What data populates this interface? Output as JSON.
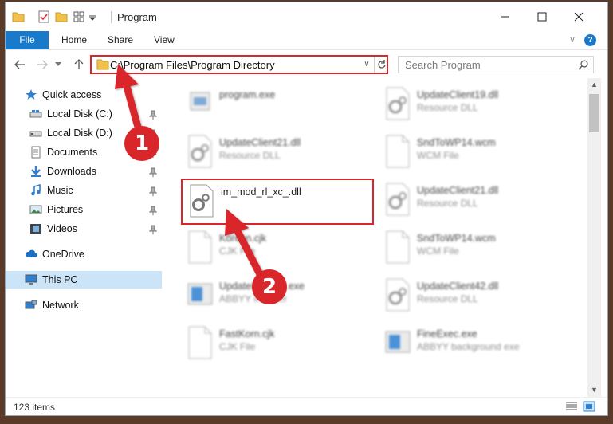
{
  "window": {
    "title": "Program",
    "controls": {
      "minimize": "minimize-icon",
      "maximize": "maximize-icon",
      "close": "close-icon"
    }
  },
  "ribbon": {
    "tabs": [
      "File",
      "Home",
      "Share",
      "View"
    ],
    "help": "?"
  },
  "address": {
    "path": "C:\\Program Files\\Program Directory",
    "search_placeholder": "Search Program"
  },
  "sidebar": {
    "quick_access": "Quick access",
    "items": [
      {
        "label": "Local Disk (C:)",
        "icon": "drive-icon",
        "pinned": true
      },
      {
        "label": "Local Disk (D:)",
        "icon": "drive-icon",
        "pinned": true
      },
      {
        "label": "Documents",
        "icon": "documents-icon",
        "pinned": true
      },
      {
        "label": "Downloads",
        "icon": "download-icon",
        "pinned": true
      },
      {
        "label": "Music",
        "icon": "music-icon",
        "pinned": true
      },
      {
        "label": "Pictures",
        "icon": "pictures-icon",
        "pinned": true
      },
      {
        "label": "Videos",
        "icon": "videos-icon",
        "pinned": true
      }
    ],
    "onedrive": "OneDrive",
    "this_pc": "This PC",
    "network": "Network"
  },
  "files": [
    {
      "name": "program.exe",
      "type": "",
      "icon": "exe-icon"
    },
    {
      "name": "UpdateClient19.dll",
      "type": "Resource DLL",
      "icon": "dll-icon"
    },
    {
      "name": "UpdateClient21.dll",
      "type": "Resource DLL",
      "icon": "dll-icon"
    },
    {
      "name": "SndToWP14.wcm",
      "type": "WCM File",
      "icon": "blank-file-icon"
    },
    {
      "name": "im_mod_rl_xc_.dll",
      "type": "",
      "icon": "dll-icon"
    },
    {
      "name": "UpdateClient21.dll",
      "type": "Resource DLL",
      "icon": "dll-icon"
    },
    {
      "name": "Korean.cjk",
      "type": "CJK File",
      "icon": "blank-file-icon"
    },
    {
      "name": "SndToWP14.wcm",
      "type": "WCM File",
      "icon": "blank-file-icon"
    },
    {
      "name": "UpdateInstaller.exe",
      "type": "ABBYY Installer",
      "icon": "exe-icon"
    },
    {
      "name": "UpdateClient42.dll",
      "type": "Resource DLL",
      "icon": "dll-icon"
    },
    {
      "name": "FastKorn.cjk",
      "type": "CJK File",
      "icon": "blank-file-icon"
    },
    {
      "name": "FineExec.exe",
      "type": "ABBYY background exe",
      "icon": "exe-icon"
    }
  ],
  "status": {
    "count": "123 items"
  },
  "annotations": {
    "step1": "1",
    "step2": "2"
  },
  "colors": {
    "accent": "#1979ca",
    "highlight": "#d9262b",
    "selected": "#cce4f7"
  }
}
